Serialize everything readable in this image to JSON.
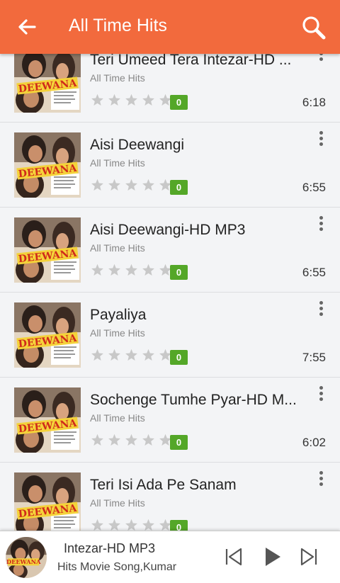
{
  "header": {
    "title": "All Time Hits",
    "back_icon": "arrow-left-icon",
    "search_icon": "search-icon"
  },
  "colors": {
    "accent": "#f26a3d",
    "badge": "#54a728",
    "star_empty": "#c8c8c8"
  },
  "songs": [
    {
      "title": "Teri Umeed Tera Intezar-HD ...",
      "album": "All Time Hits",
      "rating": 0,
      "plays": "0",
      "duration": "6:18"
    },
    {
      "title": "Aisi Deewangi",
      "album": "All Time Hits",
      "rating": 0,
      "plays": "0",
      "duration": "6:55"
    },
    {
      "title": "Aisi Deewangi-HD MP3",
      "album": "All Time Hits",
      "rating": 0,
      "plays": "0",
      "duration": "6:55"
    },
    {
      "title": "Payaliya",
      "album": "All Time Hits",
      "rating": 0,
      "plays": "0",
      "duration": "7:55"
    },
    {
      "title": "Sochenge Tumhe Pyar-HD M...",
      "album": "All Time Hits",
      "rating": 0,
      "plays": "0",
      "duration": "6:02"
    },
    {
      "title": "Teri Isi Ada Pe Sanam",
      "album": "All Time Hits",
      "rating": 0,
      "plays": "0",
      "duration": ""
    }
  ],
  "player": {
    "title": "Intezar-HD MP3",
    "subtitle": "Hits Movie Song,Kumar",
    "prev_icon": "skip-previous-icon",
    "play_icon": "play-icon",
    "next_icon": "skip-next-icon"
  },
  "album_art": {
    "logo_text": "DEEWANA"
  }
}
